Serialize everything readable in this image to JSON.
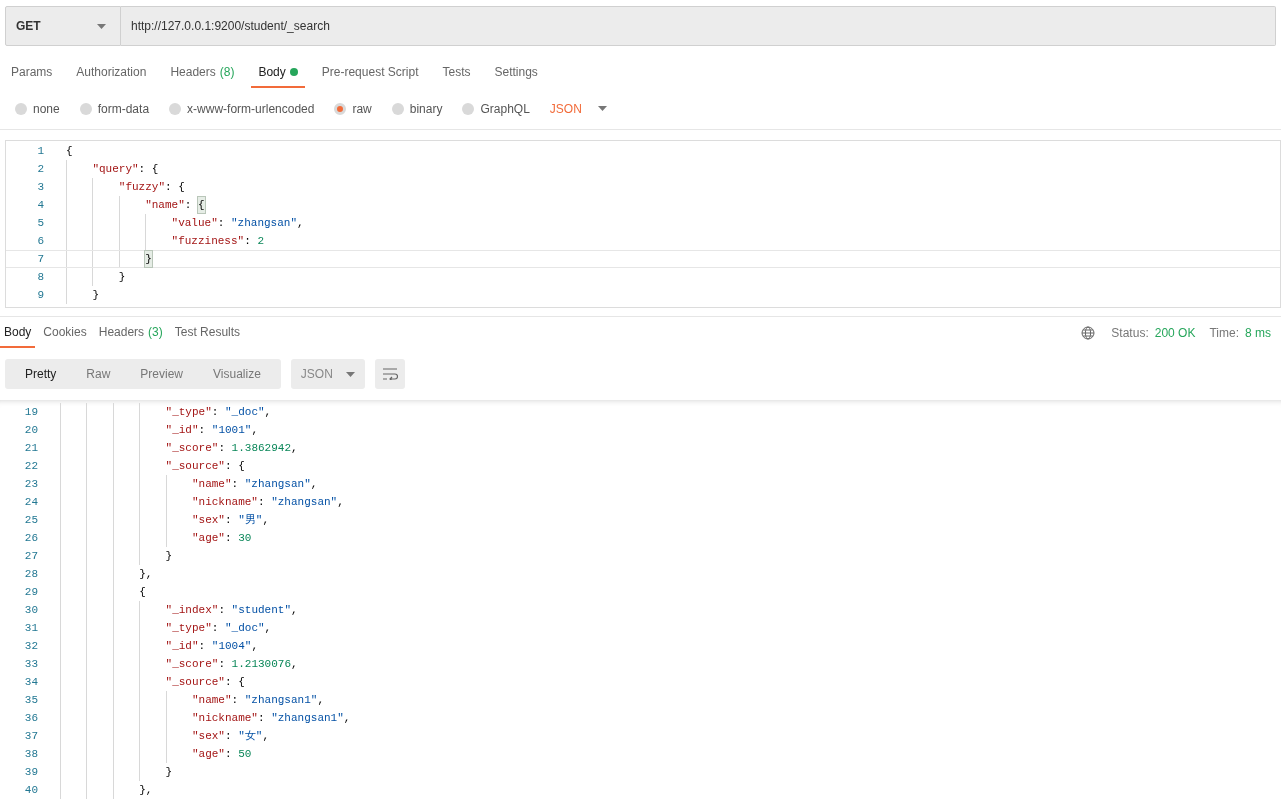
{
  "request": {
    "method": "GET",
    "url": "http://127.0.0.1:9200/student/_search"
  },
  "request_tabs": [
    {
      "label": "Params",
      "selected": false
    },
    {
      "label": "Authorization",
      "selected": false
    },
    {
      "label": "Headers",
      "count": "(8)",
      "selected": false
    },
    {
      "label": "Body",
      "dot": true,
      "selected": true
    },
    {
      "label": "Pre-request Script",
      "selected": false
    },
    {
      "label": "Tests",
      "selected": false
    },
    {
      "label": "Settings",
      "selected": false
    }
  ],
  "body_types": [
    {
      "label": "none",
      "selected": false
    },
    {
      "label": "form-data",
      "selected": false
    },
    {
      "label": "x-www-form-urlencoded",
      "selected": false
    },
    {
      "label": "raw",
      "selected": true
    },
    {
      "label": "binary",
      "selected": false
    },
    {
      "label": "GraphQL",
      "selected": false
    }
  ],
  "body_format": "JSON",
  "editor_lines": [
    {
      "number": "1",
      "current": false,
      "tokens": [
        {
          "kind": "punct",
          "text": "{"
        }
      ]
    },
    {
      "number": "2",
      "current": false,
      "tokens": [
        {
          "kind": "key",
          "text": "    \"query\""
        },
        {
          "kind": "punct",
          "text": ": {"
        }
      ]
    },
    {
      "number": "3",
      "current": false,
      "tokens": [
        {
          "kind": "key",
          "text": "        \"fuzzy\""
        },
        {
          "kind": "punct",
          "text": ": {"
        }
      ]
    },
    {
      "number": "4",
      "current": false,
      "tokens": [
        {
          "kind": "key",
          "text": "            \"name\""
        },
        {
          "kind": "punct",
          "text": ": "
        },
        {
          "kind": "match",
          "text": "{"
        }
      ]
    },
    {
      "number": "5",
      "current": false,
      "tokens": [
        {
          "kind": "key",
          "text": "                \"value\""
        },
        {
          "kind": "punct",
          "text": ": "
        },
        {
          "kind": "string",
          "text": "\"zhangsan\""
        },
        {
          "kind": "punct",
          "text": ","
        }
      ]
    },
    {
      "number": "6",
      "current": false,
      "tokens": [
        {
          "kind": "key",
          "text": "                \"fuzziness\""
        },
        {
          "kind": "punct",
          "text": ": "
        },
        {
          "kind": "number",
          "text": "2"
        }
      ]
    },
    {
      "number": "7",
      "current": true,
      "tokens": [
        {
          "kind": "match",
          "text": "            }"
        }
      ]
    },
    {
      "number": "8",
      "current": false,
      "tokens": [
        {
          "kind": "punct",
          "text": "        }"
        }
      ]
    },
    {
      "number": "9",
      "current": false,
      "tokens": [
        {
          "kind": "punct",
          "text": "    }"
        }
      ]
    }
  ],
  "response_tabs": [
    {
      "label": "Body",
      "selected": true
    },
    {
      "label": "Cookies",
      "selected": false
    },
    {
      "label": "Headers",
      "count": "(3)",
      "selected": false
    },
    {
      "label": "Test Results",
      "selected": false
    }
  ],
  "status": {
    "status_label": "Status:",
    "status_value": "200 OK",
    "time_label": "Time:",
    "time_value": "8 ms"
  },
  "view_modes": [
    {
      "label": "Pretty",
      "selected": true
    },
    {
      "label": "Raw",
      "selected": false
    },
    {
      "label": "Preview",
      "selected": false
    },
    {
      "label": "Visualize",
      "selected": false
    }
  ],
  "response_format": "JSON",
  "response_lines": [
    {
      "number": "19",
      "tokens": [
        {
          "kind": "key",
          "text": "                \"_type\""
        },
        {
          "kind": "punct",
          "text": ": "
        },
        {
          "kind": "string",
          "text": "\"_doc\""
        },
        {
          "kind": "punct",
          "text": ","
        }
      ]
    },
    {
      "number": "20",
      "tokens": [
        {
          "kind": "key",
          "text": "                \"_id\""
        },
        {
          "kind": "punct",
          "text": ": "
        },
        {
          "kind": "string",
          "text": "\"1001\""
        },
        {
          "kind": "punct",
          "text": ","
        }
      ]
    },
    {
      "number": "21",
      "tokens": [
        {
          "kind": "key",
          "text": "                \"_score\""
        },
        {
          "kind": "punct",
          "text": ": "
        },
        {
          "kind": "number",
          "text": "1.3862942"
        },
        {
          "kind": "punct",
          "text": ","
        }
      ]
    },
    {
      "number": "22",
      "tokens": [
        {
          "kind": "key",
          "text": "                \"_source\""
        },
        {
          "kind": "punct",
          "text": ": {"
        }
      ]
    },
    {
      "number": "23",
      "tokens": [
        {
          "kind": "key",
          "text": "                    \"name\""
        },
        {
          "kind": "punct",
          "text": ": "
        },
        {
          "kind": "string",
          "text": "\"zhangsan\""
        },
        {
          "kind": "punct",
          "text": ","
        }
      ]
    },
    {
      "number": "24",
      "tokens": [
        {
          "kind": "key",
          "text": "                    \"nickname\""
        },
        {
          "kind": "punct",
          "text": ": "
        },
        {
          "kind": "string",
          "text": "\"zhangsan\""
        },
        {
          "kind": "punct",
          "text": ","
        }
      ]
    },
    {
      "number": "25",
      "tokens": [
        {
          "kind": "key",
          "text": "                    \"sex\""
        },
        {
          "kind": "punct",
          "text": ": "
        },
        {
          "kind": "string",
          "text": "\"男\""
        },
        {
          "kind": "punct",
          "text": ","
        }
      ]
    },
    {
      "number": "26",
      "tokens": [
        {
          "kind": "key",
          "text": "                    \"age\""
        },
        {
          "kind": "punct",
          "text": ": "
        },
        {
          "kind": "number",
          "text": "30"
        }
      ]
    },
    {
      "number": "27",
      "tokens": [
        {
          "kind": "punct",
          "text": "                }"
        }
      ]
    },
    {
      "number": "28",
      "tokens": [
        {
          "kind": "punct",
          "text": "            },"
        }
      ]
    },
    {
      "number": "29",
      "tokens": [
        {
          "kind": "punct",
          "text": "            {"
        }
      ]
    },
    {
      "number": "30",
      "tokens": [
        {
          "kind": "key",
          "text": "                \"_index\""
        },
        {
          "kind": "punct",
          "text": ": "
        },
        {
          "kind": "string",
          "text": "\"student\""
        },
        {
          "kind": "punct",
          "text": ","
        }
      ]
    },
    {
      "number": "31",
      "tokens": [
        {
          "kind": "key",
          "text": "                \"_type\""
        },
        {
          "kind": "punct",
          "text": ": "
        },
        {
          "kind": "string",
          "text": "\"_doc\""
        },
        {
          "kind": "punct",
          "text": ","
        }
      ]
    },
    {
      "number": "32",
      "tokens": [
        {
          "kind": "key",
          "text": "                \"_id\""
        },
        {
          "kind": "punct",
          "text": ": "
        },
        {
          "kind": "string",
          "text": "\"1004\""
        },
        {
          "kind": "punct",
          "text": ","
        }
      ]
    },
    {
      "number": "33",
      "tokens": [
        {
          "kind": "key",
          "text": "                \"_score\""
        },
        {
          "kind": "punct",
          "text": ": "
        },
        {
          "kind": "number",
          "text": "1.2130076"
        },
        {
          "kind": "punct",
          "text": ","
        }
      ]
    },
    {
      "number": "34",
      "tokens": [
        {
          "kind": "key",
          "text": "                \"_source\""
        },
        {
          "kind": "punct",
          "text": ": {"
        }
      ]
    },
    {
      "number": "35",
      "tokens": [
        {
          "kind": "key",
          "text": "                    \"name\""
        },
        {
          "kind": "punct",
          "text": ": "
        },
        {
          "kind": "string",
          "text": "\"zhangsan1\""
        },
        {
          "kind": "punct",
          "text": ","
        }
      ]
    },
    {
      "number": "36",
      "tokens": [
        {
          "kind": "key",
          "text": "                    \"nickname\""
        },
        {
          "kind": "punct",
          "text": ": "
        },
        {
          "kind": "string",
          "text": "\"zhangsan1\""
        },
        {
          "kind": "punct",
          "text": ","
        }
      ]
    },
    {
      "number": "37",
      "tokens": [
        {
          "kind": "key",
          "text": "                    \"sex\""
        },
        {
          "kind": "punct",
          "text": ": "
        },
        {
          "kind": "string",
          "text": "\"女\""
        },
        {
          "kind": "punct",
          "text": ","
        }
      ]
    },
    {
      "number": "38",
      "tokens": [
        {
          "kind": "key",
          "text": "                    \"age\""
        },
        {
          "kind": "punct",
          "text": ": "
        },
        {
          "kind": "number",
          "text": "50"
        }
      ]
    },
    {
      "number": "39",
      "tokens": [
        {
          "kind": "punct",
          "text": "                }"
        }
      ]
    },
    {
      "number": "40",
      "tokens": [
        {
          "kind": "punct",
          "text": "            },"
        }
      ]
    }
  ]
}
